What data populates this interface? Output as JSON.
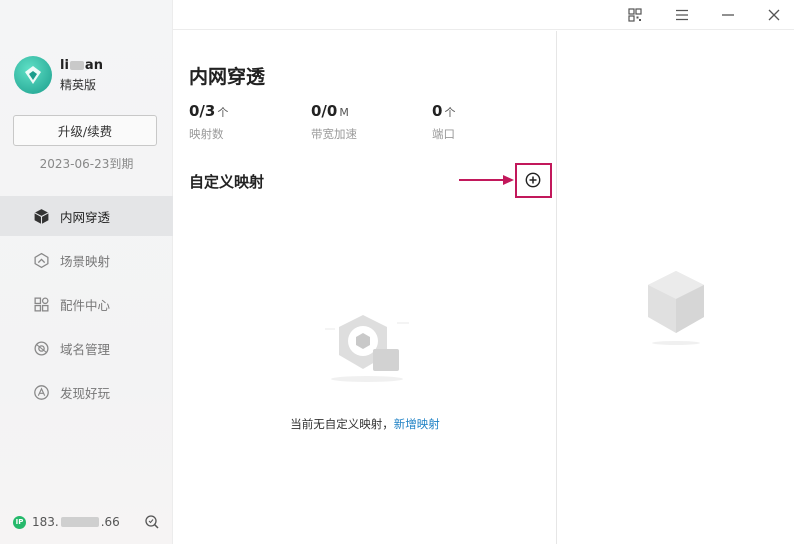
{
  "user": {
    "name_start": "li",
    "name_end": "an",
    "tier": "精英版"
  },
  "sidebar": {
    "upgrade_label": "升级/续费",
    "expire_text": "2023-06-23到期",
    "nav": [
      {
        "label": "内网穿透",
        "icon": "cube-icon",
        "active": true
      },
      {
        "label": "场景映射",
        "icon": "scene-icon"
      },
      {
        "label": "配件中心",
        "icon": "grid-icon"
      },
      {
        "label": "域名管理",
        "icon": "domain-icon"
      },
      {
        "label": "发现好玩",
        "icon": "discover-icon"
      }
    ],
    "ip_badge": "IP",
    "ip_start": "183.",
    "ip_end": ".66"
  },
  "main": {
    "title": "内网穿透",
    "stats": [
      {
        "value": "0/3",
        "unit": "个",
        "label": "映射数"
      },
      {
        "value": "0/0",
        "unit": "M",
        "label": "带宽加速"
      },
      {
        "value": "0",
        "unit": "个",
        "label": "端口"
      }
    ],
    "section_title": "自定义映射",
    "empty_text": "当前无自定义映射，",
    "empty_link": "新增映射"
  },
  "colors": {
    "accent_link": "#1a7fc4",
    "highlight": "#c2185b",
    "ip_green": "#26b96b"
  }
}
